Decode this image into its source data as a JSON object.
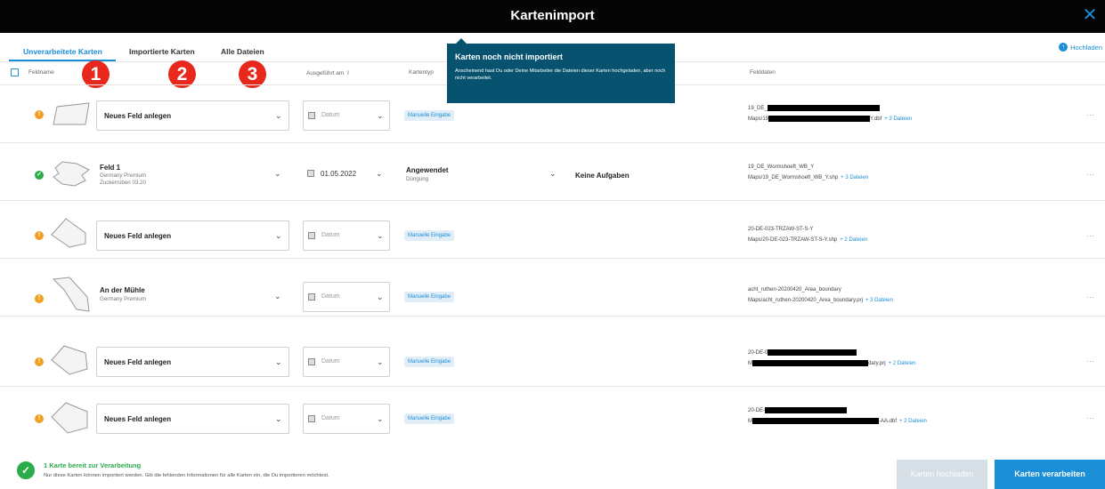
{
  "window": {
    "title": "Kartenimport",
    "close_icon": "close-icon"
  },
  "tabs": [
    {
      "label": "Unverarbeitete Karten",
      "active": true
    },
    {
      "label": "Importierte Karten",
      "active": false
    },
    {
      "label": "Alle Dateien",
      "active": false
    }
  ],
  "upload_link": {
    "label": "Hochladen",
    "icon": "upload-icon"
  },
  "markers": [
    "1",
    "2",
    "3"
  ],
  "columns": {
    "field_name": "Feldname",
    "executed_on": "Ausgeführt am",
    "sort_icon": "sort-icon",
    "map_type": "Kartentyp",
    "field_data": "Felddaten"
  },
  "tooltip": {
    "title": "Karten noch nicht importiert",
    "body": "Anscheinend hast Du oder Deine Mitarbeiter die Dateien dieser Karten hochgeladen, aber noch nicht verarbeitet."
  },
  "rows": [
    {
      "status": "warning",
      "field": "Neues Feld anlegen",
      "date": "Datum",
      "badge": "Manuelle Eingabe",
      "fd_line1": "19_DE_",
      "fd_line2_prefix": "Maps/19",
      "fd_line2_suffix": "Y.dbf",
      "more": "+ 3 Dateien"
    },
    {
      "status": "ok",
      "field": "Feld 1",
      "field_sub1": "Germany Premium",
      "field_sub2": "Zuckerrüben 03.20",
      "date": "01.05.2022",
      "type_title": "Angewendet",
      "type_sub": "Düngung",
      "tasks": "Keine Aufgaben",
      "fd_line1": "19_DE_Wormshoeft_WB_Y",
      "fd_line2_prefix": "Maps/19_DE_Wormshoeft_WB_Y.shp",
      "fd_line2_suffix": "",
      "more": "+ 3 Dateien"
    },
    {
      "status": "warning",
      "field": "Neues Feld anlegen",
      "date": "Datum",
      "badge": "Manuelle Eingabe",
      "fd_line1": "20-DE-023-TRZAW-ST-S-Y",
      "fd_line2_prefix": "Maps/20-DE-023-TRZAW-ST-S-Y.shp",
      "fd_line2_suffix": "",
      "more": "+ 2 Dateien"
    },
    {
      "status": "warning",
      "field": "An der Mühle",
      "field_sub1": "Germany Premium",
      "date": "Datum",
      "badge": "Manuelle Eingabe",
      "fd_line1": "acht_ruthen-20200420_Area_boundary",
      "fd_line2_prefix": "Maps/acht_ruthen-20200420_Area_boundary.prj",
      "fd_line2_suffix": "",
      "more": "+ 3 Dateien"
    },
    {
      "status": "warning",
      "field": "Neues Feld anlegen",
      "date": "Datum",
      "badge": "Manuelle Eingabe",
      "fd_line1": "20-DE-0",
      "fd_line2_prefix": "M",
      "fd_line2_suffix": "dary.prj",
      "more": "+ 2 Dateien"
    },
    {
      "status": "warning",
      "field": "Neues Feld anlegen",
      "date": "Datum",
      "badge": "Manuelle Eingabe",
      "fd_line1": "20-DE-",
      "fd_line2_prefix": "M",
      "fd_line2_suffix": "-AA.dbf",
      "more": "+ 2 Dateien"
    }
  ],
  "footer": {
    "ready": "1 Karte bereit zur Verarbeitung",
    "hint": "Nur diese Karten können importiert werden. Gib die fehlenden Informationen für alle Karten ein, die Du importieren möchtest.",
    "upload_button": "Karten hochladen",
    "process_button": "Karten verarbeiten"
  },
  "colors": {
    "accent": "#1a8ed6",
    "warning": "#f0a020",
    "success": "#2bab4a",
    "tooltip": "#07536f",
    "marker": "#e8281c"
  }
}
